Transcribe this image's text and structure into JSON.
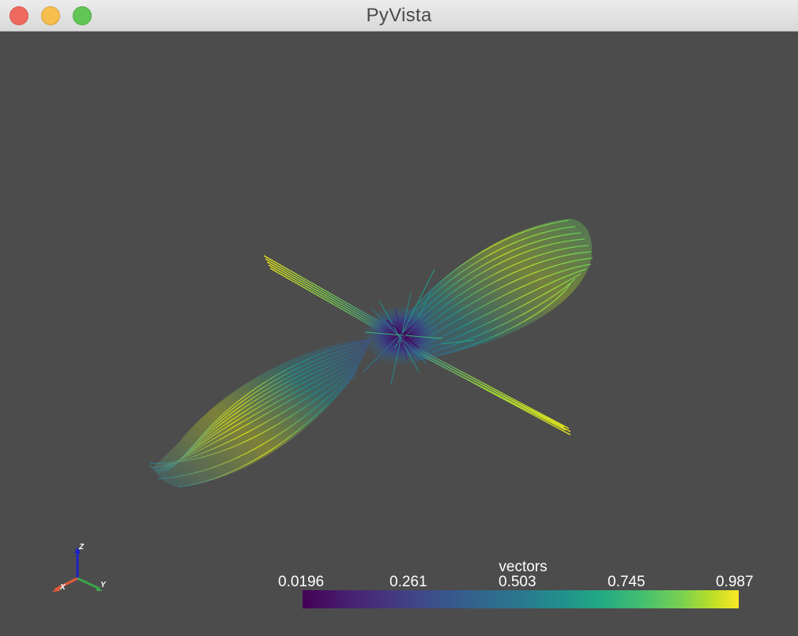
{
  "window": {
    "title": "PyVista",
    "buttons": [
      "close",
      "minimize",
      "maximize"
    ]
  },
  "viewport": {
    "background": "#4c4c4c",
    "scene": "streamlines"
  },
  "scalar_bar": {
    "title": "vectors",
    "colormap": "viridis",
    "ticks": [
      "0.0196",
      "0.261",
      "0.503",
      "0.745",
      "0.987"
    ]
  },
  "axes_widget": {
    "x_label": "X",
    "y_label": "Y",
    "z_label": "Z",
    "x_color": "#e85a3a",
    "y_color": "#3aa54a",
    "z_color": "#2020c8"
  }
}
